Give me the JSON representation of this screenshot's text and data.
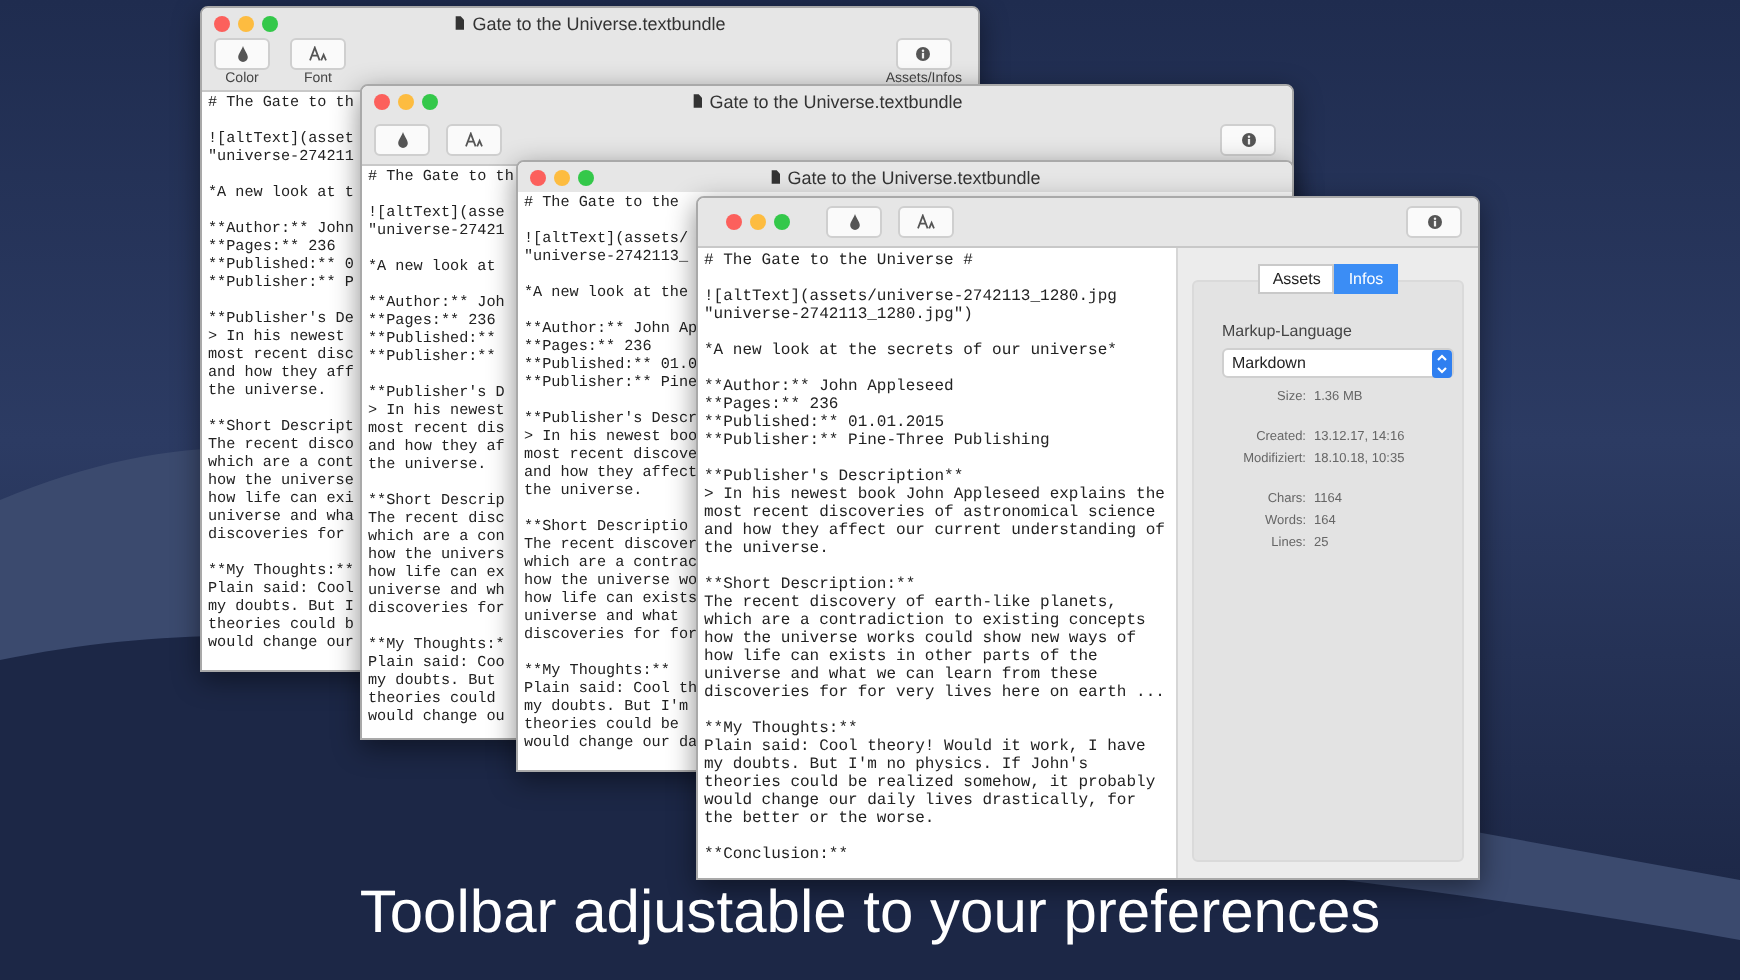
{
  "windows": [
    {
      "title": "Gate to the Universe.textbundle",
      "toolbar": {
        "kind": "labeled",
        "buttons": [
          {
            "kind": "color",
            "label": "Color"
          },
          {
            "kind": "font",
            "label": "Font"
          },
          {
            "kind": "info",
            "label": "Assets/Infos"
          }
        ]
      },
      "paragraphs": [
        [
          "# The Gate to th"
        ],
        [
          "![altText](asset",
          "\"universe-274211"
        ],
        [
          "*A new look at t"
        ],
        [
          "**Author:** John",
          "**Pages:** 236",
          "**Published:** 0",
          "**Publisher:** P"
        ],
        [
          "**Publisher's De",
          "> In his newest",
          "most recent disc",
          "and how they aff",
          "the universe."
        ],
        [
          "**Short Descript",
          "The recent disco",
          "which are a cont",
          "how the universe",
          "how life can exi",
          "universe and wha",
          "discoveries for"
        ],
        [
          "**My Thoughts:**",
          "Plain said: Cool",
          "my doubts. But I",
          "theories could b",
          "would change our"
        ]
      ]
    },
    {
      "title": "Gate to the Universe.textbundle",
      "toolbar": {
        "kind": "compact",
        "buttons": [
          {
            "kind": "color"
          },
          {
            "kind": "font"
          },
          {
            "kind": "info"
          }
        ]
      },
      "paragraphs": [
        [
          "# The Gate to th"
        ],
        [
          "![altText](asse",
          "\"universe-27421"
        ],
        [
          "*A new look at"
        ],
        [
          "**Author:** Joh",
          "**Pages:** 236",
          "**Published:**",
          "**Publisher:**"
        ],
        [
          "**Publisher's D",
          "> In his newest",
          "most recent dis",
          "and how they af",
          "the universe."
        ],
        [
          "**Short Descrip",
          "The recent disc",
          "which are a con",
          "how the univers",
          "how life can ex",
          "universe and wh",
          "discoveries for"
        ],
        [
          "**My Thoughts:*",
          "Plain said: Coo",
          "my doubts. But",
          "theories could",
          "would change ou"
        ]
      ]
    },
    {
      "title": "Gate to the Universe.textbundle",
      "paragraphs": [
        [
          "# The Gate to the"
        ],
        [
          "![altText](assets/",
          "\"universe-2742113_"
        ],
        [
          "*A new look at the"
        ],
        [
          "**Author:** John Ap",
          "**Pages:** 236",
          "**Published:** 01.0",
          "**Publisher:** Pine"
        ],
        [
          "**Publisher's Descr",
          "> In his newest boo",
          "most recent discove",
          "and how they affect",
          "the universe."
        ],
        [
          "**Short Descriptio",
          "The recent discover",
          "which are a contrac",
          "how the universe wo",
          "how life can exists",
          "universe and what",
          "discoveries for for"
        ],
        [
          "**My Thoughts:**",
          "Plain said: Cool th",
          "my doubts. But I'm",
          "theories could be",
          "would change our da"
        ]
      ]
    },
    {
      "toolbar": {
        "kind": "compact",
        "buttons": [
          {
            "kind": "color"
          },
          {
            "kind": "font"
          },
          {
            "kind": "info"
          }
        ]
      },
      "paragraphs": [
        [
          "# The Gate to the Universe #"
        ],
        [
          "![altText](assets/universe-2742113_1280.jpg",
          "\"universe-2742113_1280.jpg\")"
        ],
        [
          "*A new look at the secrets of our universe*"
        ],
        [
          "**Author:** John Appleseed",
          "**Pages:** 236",
          "**Published:** 01.01.2015",
          "**Publisher:** Pine-Three Publishing"
        ],
        [
          "**Publisher's Description**",
          "> In his newest book John Appleseed explains the",
          "most recent discoveries of astronomical science",
          "and how they affect our current understanding of",
          "the universe."
        ],
        [
          "**Short Description:**",
          "The recent discovery of earth-like planets,",
          "which are a contradiction to existing concepts",
          "how the universe works could show new ways of",
          "how life can exists in other parts of the",
          "universe and what we can learn from these",
          "discoveries for for very lives here on earth ..."
        ],
        [
          "**My Thoughts:**",
          "Plain said: Cool theory! Would it work, I have",
          "my doubts. But I'm no physics. If John's",
          "theories could be realized somehow, it probably",
          "would change our daily lives drastically, for",
          "the better or the worse."
        ],
        [
          "**Conclusion:**"
        ]
      ],
      "inspector": {
        "tabs": [
          {
            "label": "Assets",
            "selected": false
          },
          {
            "label": "Infos",
            "selected": true
          }
        ],
        "markup_label": "Markup-Language",
        "markup_value": "Markdown",
        "groups": [
          [
            {
              "label": "Size:",
              "value": "1.36 MB"
            }
          ],
          [
            {
              "label": "Created:",
              "value": "13.12.17, 14:16"
            },
            {
              "label": "Modifiziert:",
              "value": "18.10.18, 10:35"
            }
          ],
          [
            {
              "label": "Chars:",
              "value": "1164"
            },
            {
              "label": "Words:",
              "value": "164"
            },
            {
              "label": "Lines:",
              "value": "25"
            }
          ]
        ]
      }
    }
  ],
  "caption": "Toolbar adjustable to your preferences"
}
